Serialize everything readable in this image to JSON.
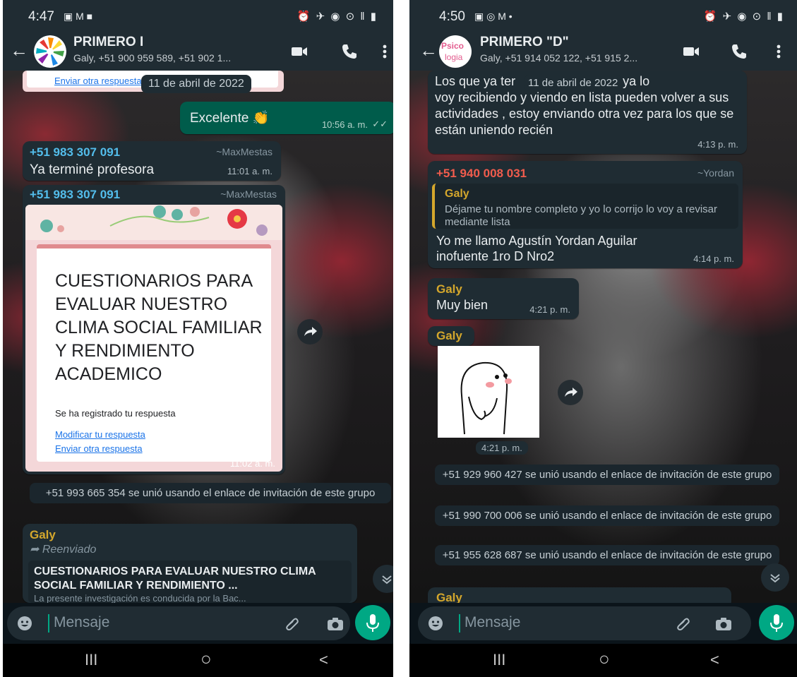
{
  "left": {
    "status": {
      "time": "4:47",
      "icons": "▣ M ■",
      "right_icons": "⏰ ✈ ◉ ⊙ ‖ ▮"
    },
    "header": {
      "title": "PRIMERO I",
      "subtitle": "Galy, +51 900 959 589, +51 902 1..."
    },
    "form_top_link": "Enviar otra respuesta",
    "date_chip": "11 de abril de 2022",
    "out_msg": {
      "text": "Excelente 👏",
      "time": "10:56 a. m.",
      "ticks": "✓✓"
    },
    "msg1": {
      "sender": "+51 983 307 091",
      "alias": "~MaxMestas",
      "text": "Ya terminé profesora",
      "time": "11:01 a. m."
    },
    "msg2": {
      "sender": "+51 983 307 091",
      "alias": "~MaxMestas",
      "time": "11:02 a. m.",
      "form_title": "CUESTIONARIOS PARA EVALUAR NUESTRO CLIMA SOCIAL FAMILIAR Y RENDIMIENTO ACADEMICO",
      "form_note": "Se ha registrado tu respuesta",
      "link1": "Modificar tu respuesta",
      "link2": "Enviar otra respuesta"
    },
    "sys1": "+51 993 665 354 se unió usando el enlace de invitación de este grupo",
    "msg3": {
      "sender": "Galy",
      "forwarded": "Reenviado",
      "preview_title": "CUESTIONARIOS PARA EVALUAR NUESTRO CLIMA SOCIAL FAMILIAR Y RENDIMIENTO ...",
      "preview_desc": "La presente investigación es conducida por la Bac..."
    },
    "input_placeholder": "Mensaje",
    "accent": "#00a884"
  },
  "right": {
    "status": {
      "time": "4:50",
      "icons": "▣ ◎ M •",
      "right_icons": "⏰ ✈ ◉ ⊙ ‖ ▮"
    },
    "header": {
      "title": "PRIMERO \"D\"",
      "subtitle": "Galy, +51 914 052 122, +51 915 2...",
      "avatar_text1": "Psico",
      "avatar_text2": "logia"
    },
    "msg0": {
      "text": "Los que ya terminaron ya los voy recibiendo y viendo en lista pueden volver a sus actividades , estoy enviando otra vez para los que se están uniendo recién",
      "text_visible_a": "Los que ya ter",
      "text_visible_b": "os ya lo",
      "text_rest": "voy recibiendo y viendo en lista pueden volver a sus actividades , estoy enviando otra vez para los que se están uniendo recién",
      "time": "4:13 p. m."
    },
    "date_chip": "11 de abril de 2022",
    "msg1": {
      "sender": "+51 940 008 031",
      "alias": "~Yordan",
      "quote_author": "Galy",
      "quote_text": "Déjame tu nombre completo y yo lo corrijo lo voy a revisar mediante lista",
      "text": "Yo me llamo Agustín Yordan Aguilar inofuente 1ro D Nro2",
      "time": "4:14 p. m."
    },
    "msg2": {
      "sender": "Galy",
      "text": "Muy bien",
      "time": "4:21 p. m."
    },
    "msg3": {
      "sender": "Galy",
      "time": "4:21 p. m."
    },
    "sys1": "+51 929 960 427 se unió usando el enlace de invitación de este grupo",
    "sys2": "+51 990 700 006 se unió usando el enlace de invitación de este grupo",
    "sys3": "+51 955 628 687 se unió usando el enlace de invitación de este grupo",
    "msg4": {
      "sender": "Galy"
    },
    "input_placeholder": "Mensaje"
  },
  "navbar": {
    "recents": "III",
    "home": "○",
    "back": "<"
  }
}
